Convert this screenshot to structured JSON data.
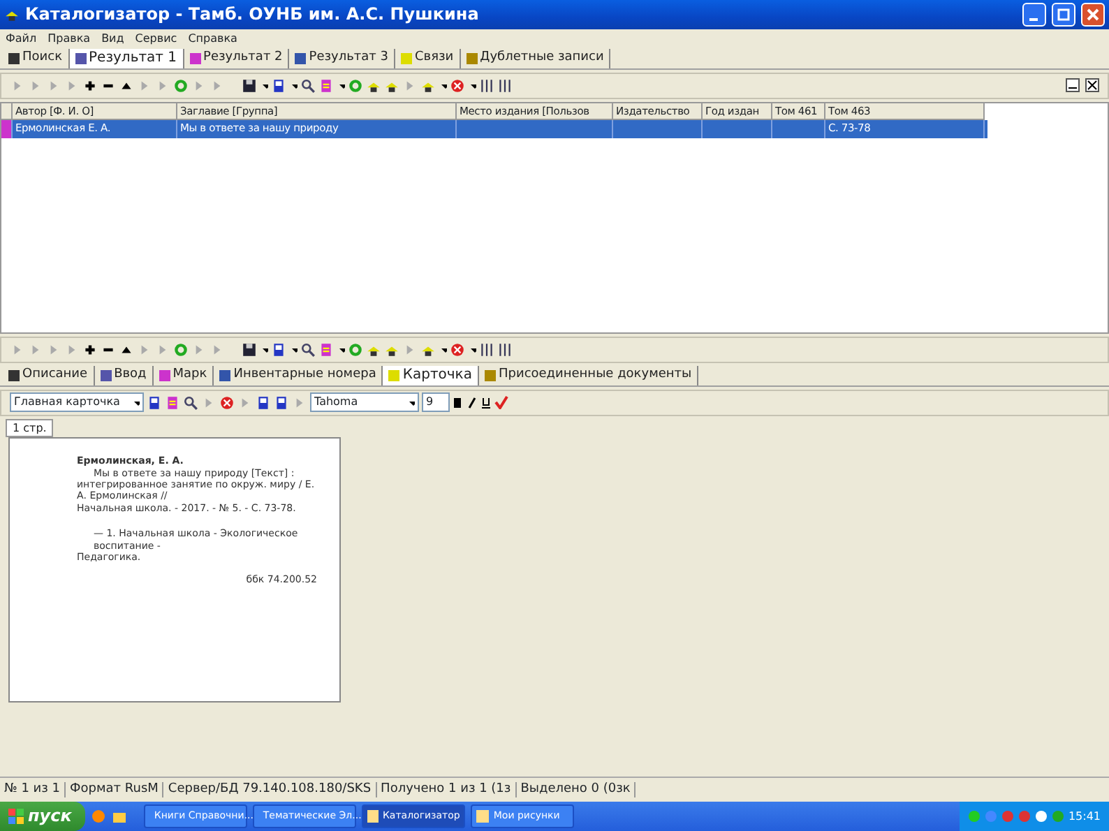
{
  "window": {
    "title": "Каталогизатор - Тамб. ОУНБ им. А.С. Пушкина"
  },
  "menu": [
    "Файл",
    "Правка",
    "Вид",
    "Сервис",
    "Справка"
  ],
  "tabs": [
    {
      "label": "Поиск",
      "selected": false
    },
    {
      "label": "Результат 1",
      "selected": true
    },
    {
      "label": "Результат 2",
      "selected": false
    },
    {
      "label": "Результат 3",
      "selected": false
    },
    {
      "label": "Связи",
      "selected": false
    },
    {
      "label": "Дублетные записи",
      "selected": false
    }
  ],
  "table": {
    "columns": [
      "Автор [Ф. И. О]",
      "Заглавие [Группа]",
      "Место издания [Пользов",
      "Издательство",
      "Год издан",
      "Том 461",
      "Том 463"
    ],
    "rows": [
      {
        "selected": true,
        "cells": [
          "Ермолинская Е. А.",
          "Мы в ответе за нашу природу",
          "",
          "",
          "",
          "",
          "С. 73-78"
        ]
      }
    ]
  },
  "detail_tabs": [
    {
      "label": "Описание",
      "selected": false
    },
    {
      "label": "Ввод",
      "selected": false
    },
    {
      "label": "Марк",
      "selected": false
    },
    {
      "label": "Инвентарные номера",
      "selected": false
    },
    {
      "label": "Карточка",
      "selected": true
    },
    {
      "label": "Присоединенные документы",
      "selected": false
    }
  ],
  "format_toolbar": {
    "card_type": "Главная карточка",
    "font": "Tahoma",
    "size": "9"
  },
  "page_tab": "1 стр.",
  "card": {
    "heading": "Ермолинская, Е. А.",
    "lines": [
      "Мы в ответе за нашу природу [Текст] :",
      "интегрированное занятие по окруж. миру / Е. А. Ермолинская //",
      "Начальная школа. - 2017. - № 5. - С. 73-78."
    ],
    "subjects": [
      "— 1. Начальная школа - Экологическое воспитание -",
      "Педагогика."
    ],
    "code": "ббк 74.200.52"
  },
  "status_bar": [
    "№ 1 из 1",
    "Формат RusM",
    "Сервер/БД 79.140.108.180/SKS",
    "Получено 1 из 1 (1з",
    "Выделено 0 (0зк"
  ],
  "taskbar": {
    "start": "пуск",
    "tasks": [
      {
        "label": "Книги Справочни...",
        "selected": false
      },
      {
        "label": "Тематические Эл...",
        "selected": false
      },
      {
        "label": "Каталогизатор",
        "selected": true
      },
      {
        "label": "Мои рисунки",
        "selected": false
      }
    ],
    "clock": "15:41"
  }
}
